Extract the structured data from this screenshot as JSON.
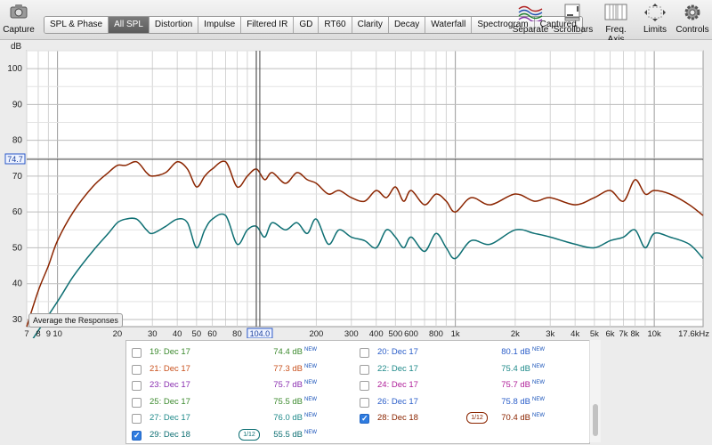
{
  "toolbar": {
    "capture_label": "Capture",
    "tabs": [
      {
        "label": "SPL & Phase",
        "active": false
      },
      {
        "label": "All SPL",
        "active": true
      },
      {
        "label": "Distortion",
        "active": false
      },
      {
        "label": "Impulse",
        "active": false
      },
      {
        "label": "Filtered IR",
        "active": false
      },
      {
        "label": "GD",
        "active": false
      },
      {
        "label": "RT60",
        "active": false
      },
      {
        "label": "Clarity",
        "active": false
      },
      {
        "label": "Decay",
        "active": false
      },
      {
        "label": "Waterfall",
        "active": false
      },
      {
        "label": "Spectrogram",
        "active": false
      },
      {
        "label": "Captured",
        "active": false
      }
    ],
    "right_tools": [
      {
        "label": "Separate",
        "icon": "separate-icon"
      },
      {
        "label": "Scrollbars",
        "icon": "scrollbars-icon"
      },
      {
        "label": "Freq. Axis",
        "icon": "freq-axis-icon"
      },
      {
        "label": "Limits",
        "icon": "limits-icon"
      },
      {
        "label": "Controls",
        "icon": "gear-icon"
      }
    ]
  },
  "graph": {
    "y_unit": "dB",
    "y_ticks": [
      "30",
      "40",
      "50",
      "60",
      "70",
      "80",
      "90",
      "100"
    ],
    "x_ticks": [
      "7",
      "8",
      "9",
      "10",
      "20",
      "30",
      "40",
      "50",
      "60",
      "80",
      "100",
      "200",
      "300",
      "400",
      "500",
      "600",
      "800",
      "1k",
      "2k",
      "3k",
      "4k",
      "5k",
      "6k",
      "7k",
      "8k",
      "10k",
      "17.6kHz"
    ],
    "cursor_y_value": "74.7",
    "cursor_x_value": "104.0",
    "average_button_label": "Average the Responses"
  },
  "legend": {
    "rows": [
      {
        "left": {
          "name": "19: Dec 17",
          "value": "74.4 dB",
          "checked": false,
          "color": "#3c8a2e"
        },
        "right": {
          "name": "20: Dec 17",
          "value": "80.1 dB",
          "checked": false,
          "color": "#2b5ec9"
        }
      },
      {
        "left": {
          "name": "21: Dec 17",
          "value": "77.3 dB",
          "checked": false,
          "color": "#c9521e"
        },
        "right": {
          "name": "22: Dec 17",
          "value": "75.4 dB",
          "checked": false,
          "color": "#1f8a8a"
        }
      },
      {
        "left": {
          "name": "23: Dec 17",
          "value": "75.7 dB",
          "checked": false,
          "color": "#8a2fb0"
        },
        "right": {
          "name": "24: Dec 17",
          "value": "75.7 dB",
          "checked": false,
          "color": "#b0209a"
        }
      },
      {
        "left": {
          "name": "25: Dec 17",
          "value": "75.5 dB",
          "checked": false,
          "color": "#3c8a2e"
        },
        "right": {
          "name": "26: Dec 17",
          "value": "75.8 dB",
          "checked": false,
          "color": "#2b5ec9"
        }
      },
      {
        "left": {
          "name": "27: Dec 17",
          "value": "76.0 dB",
          "checked": false,
          "color": "#1f8a8a"
        },
        "right": {
          "name": "28: Dec 18",
          "value": "70.4 dB",
          "checked": true,
          "color": "#8b2500",
          "smoothing": "1/12"
        }
      },
      {
        "left": {
          "name": "29: Dec 18",
          "value": "55.5 dB",
          "checked": true,
          "color": "#0e6f73",
          "smoothing": "1/12"
        }
      }
    ],
    "new_badge": "NEW"
  },
  "chart_data": {
    "type": "line",
    "ylabel": "dB",
    "xlim": [
      7,
      17600
    ],
    "ylim": [
      28,
      105
    ],
    "x_scale": "log",
    "series": [
      {
        "name": "28: Dec 18",
        "color": "#8b2500",
        "x": [
          7,
          8,
          9,
          10,
          12,
          15,
          18,
          20,
          22,
          25,
          28,
          30,
          35,
          40,
          45,
          50,
          55,
          60,
          70,
          80,
          90,
          100,
          110,
          120,
          140,
          160,
          180,
          200,
          230,
          260,
          300,
          350,
          400,
          450,
          500,
          550,
          600,
          700,
          800,
          900,
          1000,
          1200,
          1500,
          2000,
          2500,
          3000,
          4000,
          5000,
          6000,
          7000,
          8000,
          9000,
          10000,
          12000,
          15000,
          17600
        ],
        "y": [
          28,
          38,
          45,
          52,
          60,
          67,
          71,
          73,
          73,
          74,
          71,
          70,
          71,
          74,
          72,
          67,
          70,
          72,
          74,
          67,
          70,
          72,
          69,
          71,
          68,
          71,
          69,
          68,
          65,
          66,
          64,
          63,
          66,
          64,
          67,
          63,
          66,
          62,
          65,
          63,
          60,
          64,
          62,
          65,
          63,
          64,
          62,
          64,
          66,
          63,
          69,
          65,
          66,
          65,
          62,
          59
        ]
      },
      {
        "name": "29: Dec 18",
        "color": "#0e6f73",
        "x": [
          7,
          10,
          12,
          15,
          18,
          20,
          22,
          25,
          28,
          30,
          35,
          40,
          45,
          50,
          55,
          60,
          70,
          80,
          90,
          100,
          110,
          120,
          140,
          160,
          180,
          200,
          230,
          260,
          300,
          350,
          400,
          450,
          500,
          550,
          600,
          700,
          800,
          900,
          1000,
          1200,
          1500,
          2000,
          2500,
          3000,
          4000,
          5000,
          6000,
          7000,
          8000,
          9000,
          10000,
          12000,
          15000,
          17600
        ],
        "y": [
          22,
          35,
          42,
          49,
          54,
          57,
          58,
          58,
          55,
          54,
          56,
          58,
          57,
          50,
          55,
          58,
          59,
          51,
          55,
          56,
          53,
          57,
          55,
          57,
          54,
          58,
          51,
          55,
          53,
          52,
          50,
          55,
          53,
          50,
          53,
          49,
          54,
          50,
          47,
          52,
          51,
          55,
          54,
          53,
          51,
          50,
          52,
          53,
          55,
          50,
          54,
          53,
          51,
          47
        ]
      }
    ]
  }
}
